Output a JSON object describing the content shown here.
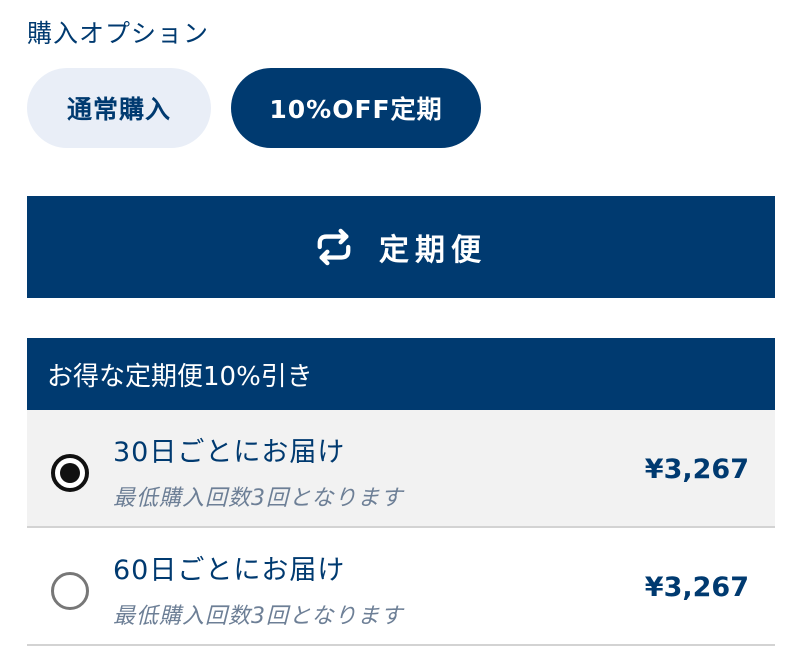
{
  "purchase_options": {
    "title": "購入オプション",
    "normal_label": "通常購入",
    "subscription_label": "10%OFF定期"
  },
  "subscription_button": {
    "icon": "repeat-icon",
    "label": "定期便"
  },
  "plans": {
    "header": "お得な定期便10%引き",
    "items": [
      {
        "label": "30日ごとにお届け",
        "note": "最低購入回数3回となります",
        "price": "¥3,267",
        "selected": true
      },
      {
        "label": "60日ごとにお届け",
        "note": "最低購入回数3回となります",
        "price": "¥3,267",
        "selected": false
      }
    ]
  },
  "colors": {
    "primary": "#003a70",
    "pill_inactive_bg": "#e9eef7",
    "selected_row_bg": "#f2f2f2",
    "note_text": "#6d7f96"
  }
}
